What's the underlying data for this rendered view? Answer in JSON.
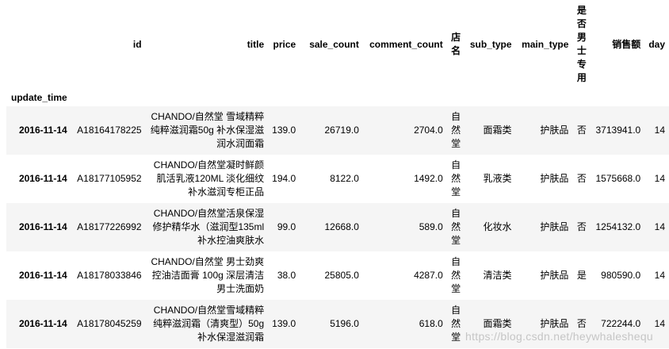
{
  "index_name": "update_time",
  "columns": {
    "id": "id",
    "title": "title",
    "price": "price",
    "sale_count": "sale_count",
    "comment_count": "comment_count",
    "shop": "店名",
    "sub_type": "sub_type",
    "main_type": "main_type",
    "male": "是否男士专用",
    "sales": "销售额",
    "day": "day"
  },
  "rows": [
    {
      "date": "2016-11-14",
      "id": "A18164178225",
      "title": "CHANDO/自然堂 雪域精粹纯粹滋润霜50g 补水保湿滋润水润面霜",
      "price": "139.0",
      "sale_count": "26719.0",
      "comment_count": "2704.0",
      "shop": "自然堂",
      "sub_type": "面霜类",
      "main_type": "护肤品",
      "male": "否",
      "sales": "3713941.0",
      "day": "14"
    },
    {
      "date": "2016-11-14",
      "id": "A18177105952",
      "title": "CHANDO/自然堂凝时鲜颜肌活乳液120ML 淡化细纹补水滋润专柜正品",
      "price": "194.0",
      "sale_count": "8122.0",
      "comment_count": "1492.0",
      "shop": "自然堂",
      "sub_type": "乳液类",
      "main_type": "护肤品",
      "male": "否",
      "sales": "1575668.0",
      "day": "14"
    },
    {
      "date": "2016-11-14",
      "id": "A18177226992",
      "title": "CHANDO/自然堂活泉保湿修护精华水（滋润型135ml 补水控油爽肤水",
      "price": "99.0",
      "sale_count": "12668.0",
      "comment_count": "589.0",
      "shop": "自然堂",
      "sub_type": "化妆水",
      "main_type": "护肤品",
      "male": "否",
      "sales": "1254132.0",
      "day": "14"
    },
    {
      "date": "2016-11-14",
      "id": "A18178033846",
      "title": "CHANDO/自然堂 男士劲爽控油洁面膏 100g 深层清洁男士洗面奶",
      "price": "38.0",
      "sale_count": "25805.0",
      "comment_count": "4287.0",
      "shop": "自然堂",
      "sub_type": "清洁类",
      "main_type": "护肤品",
      "male": "是",
      "sales": "980590.0",
      "day": "14"
    },
    {
      "date": "2016-11-14",
      "id": "A18178045259",
      "title": "CHANDO/自然堂雪域精粹纯粹滋润霜（清爽型）50g 补水保湿滋润霜",
      "price": "139.0",
      "sale_count": "5196.0",
      "comment_count": "618.0",
      "shop": "自然堂",
      "sub_type": "面霜类",
      "main_type": "护肤品",
      "male": "否",
      "sales": "722244.0",
      "day": "14"
    }
  ],
  "watermark": "https://blog.csdn.net/heywhaleshequ"
}
